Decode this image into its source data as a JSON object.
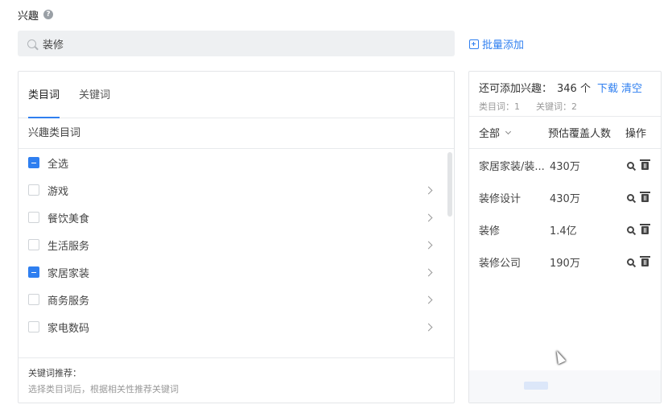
{
  "header": {
    "title": "兴趣",
    "help_glyph": "?"
  },
  "search": {
    "value": "装修"
  },
  "bulk_add": {
    "label": "批量添加"
  },
  "left_panel": {
    "tabs": [
      {
        "label": "类目词",
        "active": true
      },
      {
        "label": "关键词",
        "active": false
      }
    ],
    "section_label": "兴趣类目词",
    "items": [
      {
        "label": "全选",
        "state": "indeterminate",
        "has_children": false
      },
      {
        "label": "游戏",
        "state": "unchecked",
        "has_children": true
      },
      {
        "label": "餐饮美食",
        "state": "unchecked",
        "has_children": true
      },
      {
        "label": "生活服务",
        "state": "unchecked",
        "has_children": true
      },
      {
        "label": "家居家装",
        "state": "indeterminate",
        "has_children": true
      },
      {
        "label": "商务服务",
        "state": "unchecked",
        "has_children": true
      },
      {
        "label": "家电数码",
        "state": "unchecked",
        "has_children": true
      }
    ],
    "recommend_title": "关键词推荐：",
    "recommend_hint": "选择类目词后，根据相关性推荐关键词"
  },
  "right_panel": {
    "remaining_label": "还可添加兴趣：",
    "remaining_count": "346 个",
    "download_label": "下载",
    "clear_label": "清空",
    "category_count": "类目词：1",
    "keyword_count": "关键词：2",
    "col_all": "全部",
    "col_coverage": "预估覆盖人数",
    "col_ops": "操作",
    "rows": [
      {
        "name": "家居家装/装...",
        "coverage": "430万"
      },
      {
        "name": "装修设计",
        "coverage": "430万"
      },
      {
        "name": "装修",
        "coverage": "1.4亿"
      },
      {
        "name": "装修公司",
        "coverage": "190万"
      }
    ]
  },
  "colors": {
    "accent": "#2f7ff0",
    "border": "#e3e5e8",
    "search_bg": "#eef0f2"
  }
}
